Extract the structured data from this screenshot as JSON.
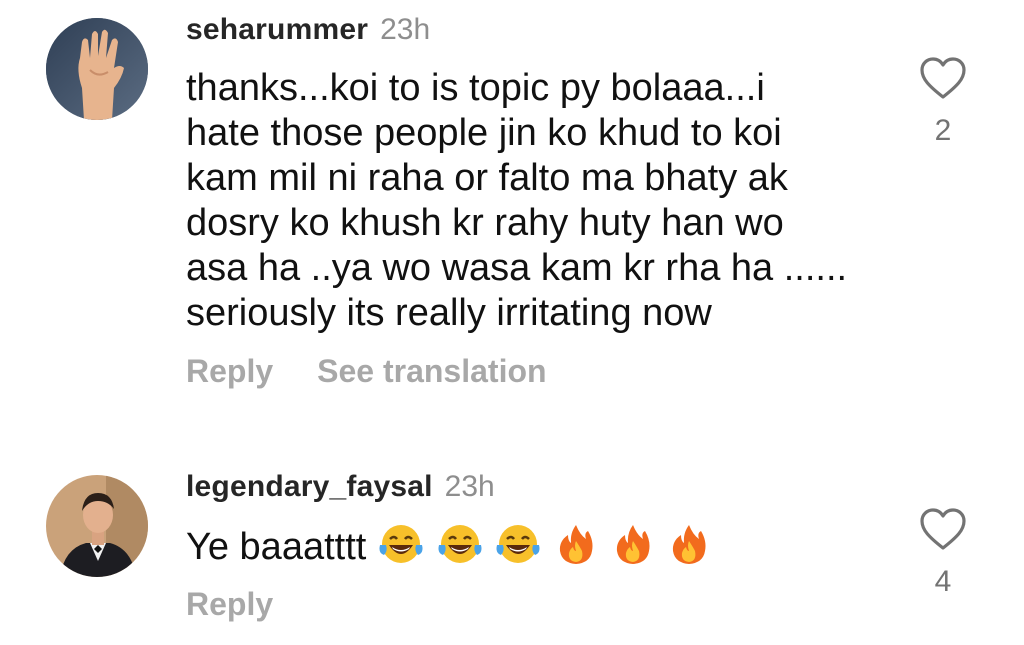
{
  "comments": [
    {
      "username": "seharummer",
      "time": "23h",
      "avatar": "raised-hand-avatar",
      "text_lines": [
        "thanks...koi to is topic py bolaaa...i",
        "hate those people jin ko khud to koi",
        "kam mil ni raha or falto ma bhaty ak",
        "dosry ko khush kr rahy huty han wo",
        "asa ha ..ya wo wasa kam kr rha ha ......",
        "seriously its really irritating now"
      ],
      "reply_label": "Reply",
      "translate_label": "See translation",
      "like_icon": "heart-outline-icon",
      "like_count": "2"
    },
    {
      "username": "legendary_faysal",
      "time": "23h",
      "avatar": "man-in-tuxedo-avatar",
      "text": "Ye baaatttt",
      "emojis": [
        "face-with-tears-of-joy",
        "face-with-tears-of-joy",
        "face-with-tears-of-joy",
        "fire",
        "fire",
        "fire"
      ],
      "reply_label": "Reply",
      "like_icon": "heart-outline-icon",
      "like_count": "4"
    }
  ],
  "colors": {
    "username": "#262626",
    "meta_gray": "#8e8e8e",
    "action_gray": "#a8a8a8",
    "text": "#111111",
    "emoji_yellow": "#f7c02a",
    "fire_orange": "#f26b1d"
  }
}
